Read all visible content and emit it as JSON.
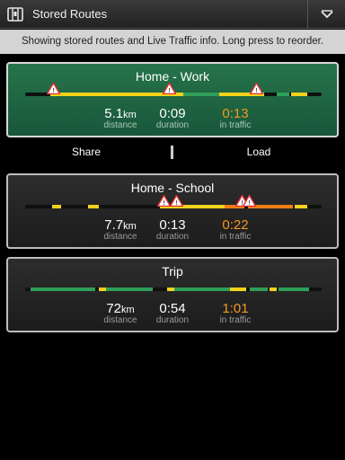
{
  "header": {
    "title": "Stored Routes",
    "app_icon": "map-book-icon",
    "menu_icon": "chevron-down-icon"
  },
  "info": {
    "text": "Showing stored routes and Live Traffic info. Long press to reorder."
  },
  "actions": {
    "share_label": "Share",
    "load_label": "Load"
  },
  "colors": {
    "selected_card": "#1f6b45",
    "traffic_green": "#2f9f5a",
    "traffic_yellow": "#f2d21c",
    "traffic_orange": "#ef7d16",
    "warning_red": "#e53030"
  },
  "routes": [
    {
      "name": "Home - Work",
      "distance_value": "5.1",
      "distance_unit": "km",
      "distance_label": "distance",
      "duration_value": "0:09",
      "duration_label": "duration",
      "traffic_value": "0:13",
      "traffic_label": "in traffic"
    },
    {
      "name": "Home - School",
      "distance_value": "7.7",
      "distance_unit": "km",
      "distance_label": "distance",
      "duration_value": "0:13",
      "duration_label": "duration",
      "traffic_value": "0:22",
      "traffic_label": "in traffic"
    },
    {
      "name": "Trip",
      "distance_value": "72",
      "distance_unit": "km",
      "distance_label": "distance",
      "duration_value": "0:54",
      "duration_label": "duration",
      "traffic_value": "1:01",
      "traffic_label": "in traffic"
    }
  ]
}
